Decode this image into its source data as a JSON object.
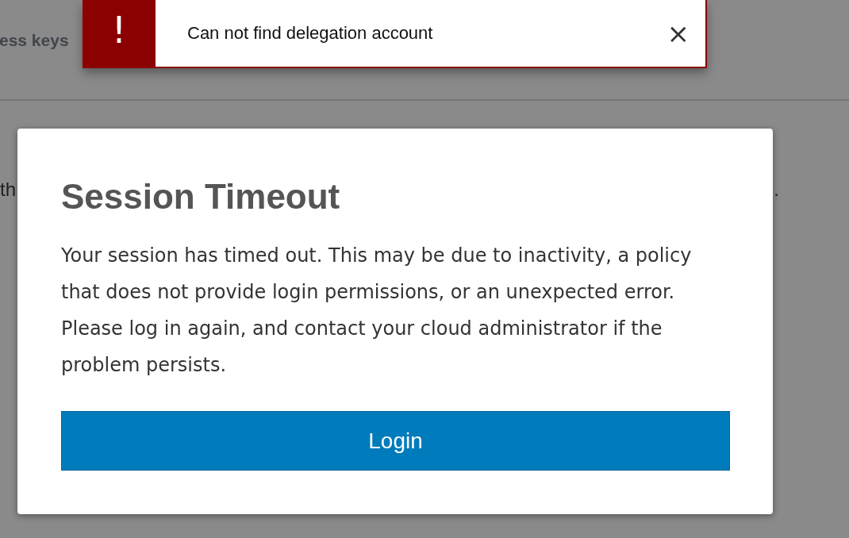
{
  "background": {
    "heading": "ess keys",
    "left_text": "th",
    "right_text": "."
  },
  "toast": {
    "icon": "!",
    "message": "Can not find delegation account",
    "close": "×"
  },
  "dialog": {
    "title": "Session Timeout",
    "message": "Your session has timed out. This may be due to inactivity, a policy that does not provide login permissions, or an unexpected error. Please log in again, and contact your cloud administrator if the problem persists.",
    "button": "Login"
  }
}
